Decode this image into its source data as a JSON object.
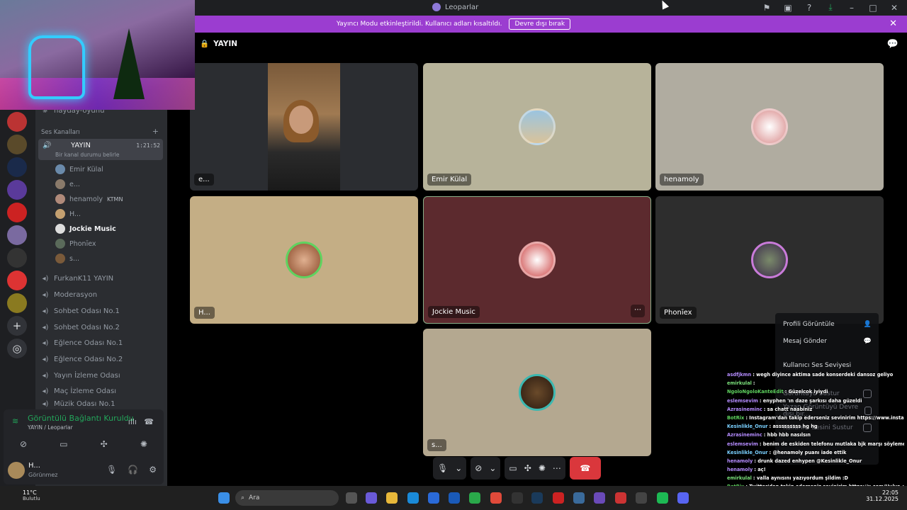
{
  "window": {
    "title": "Leoparlar"
  },
  "notice": {
    "text": "Yayıncı Modu etkinleştirildi. Kullanıcı adları kısaltıldı.",
    "button": "Devre dışı bırak"
  },
  "sidebar": {
    "top_channel": "hayday-oyunu",
    "section_title": "Ses Kanalları",
    "active_channel": {
      "name": "YAYIN",
      "status": "Bir kanal durumu belirle",
      "timer": "1:21:52"
    },
    "members": [
      {
        "name": "Emir Külal",
        "tag": ""
      },
      {
        "name": "e...",
        "tag": ""
      },
      {
        "name": "henamoly",
        "tag": "KTMN"
      },
      {
        "name": "H...",
        "tag": ""
      },
      {
        "name": "Jockie Music",
        "tag": ""
      },
      {
        "name": "Phonīex",
        "tag": ""
      },
      {
        "name": "s...",
        "tag": ""
      }
    ],
    "channels": [
      "FurkanK11 YAYIN",
      "Moderasyon",
      "Sohbet Odası No.1",
      "Sohbet Odası No.2",
      "Eğlence Odası No.1",
      "Eğlence Odası No.2",
      "Yayın İzleme Odası",
      "Maç İzleme Odası",
      "Müzik Odası No.1"
    ],
    "voice_status": {
      "title": "Görüntülü Bağlantı Kuruldu",
      "sub": "YAYIN / Leoparlar"
    },
    "user": {
      "name": "H...",
      "status": "Görünmez"
    }
  },
  "stage": {
    "header": "YAYIN",
    "tiles": [
      {
        "label": "e...",
        "bg": "#2b2d31"
      },
      {
        "label": "Emir Külal",
        "bg": "#b7b39a"
      },
      {
        "label": "henamoly",
        "bg": "#b0aca0"
      },
      {
        "label": "H...",
        "bg": "#c4ae85"
      },
      {
        "label": "Jockie Music",
        "bg": "#5c2a2e"
      },
      {
        "label": "Phonīex",
        "bg": "#2d2d2d"
      },
      {
        "label": "s...",
        "bg": "#b4a890"
      }
    ]
  },
  "context_menu": {
    "items": [
      "Profili Görüntüle",
      "Mesaj Gönder",
      "Kullanıcı Ses Seviyesi",
      "Görüntüyü Sustur",
      "Yazan Görüntüyü Devre dışı bır...",
      "Kullanıcı Sesini Sustur"
    ]
  },
  "chat": [
    {
      "user": "asdfjkmn",
      "text": ": wegh diyince aktima sade konserdeki dansoz geliyo",
      "color": "#b58cff"
    },
    {
      "user": "emirkulal",
      "text": ":",
      "color": "#7be07b"
    },
    {
      "user": "NgoloNgoloKanteEdit",
      "text": ": Güzelcok iyiydi",
      "color": "#5fd35f"
    },
    {
      "user": "eslemsevim",
      "text": ": enyphen 'ın daze şarkısı daha güzeldi",
      "color": "#b58cff"
    },
    {
      "user": "Azrasineminc",
      "text": ": sa chatt naabiniz",
      "color": "#b58cff"
    },
    {
      "user": "BotRix",
      "text": ": Instagram'dan takip ederseniz sevinirim https://www.instagram.com/hulyayar/",
      "color": "#5fd35f"
    },
    {
      "user": "Kesinlikle_Onur",
      "text": ": asssssssss hg hg",
      "color": "#7ad0ff"
    },
    {
      "user": "Azrasineminc",
      "text": ": hbb hbb nasılsın",
      "color": "#b58cff"
    },
    {
      "user": "eslemsevim",
      "text": ": benim de eskiden telefonu mutlaka bjk marşı söylemesi şildkgldgsg",
      "color": "#b58cff"
    },
    {
      "user": "Kesinlikle_Onur",
      "text": ": @henamoly puanı iade ettik",
      "color": "#7ad0ff"
    },
    {
      "user": "henamoly",
      "text": ": drunk dazed enhypen @Kesinlikle_Onur",
      "color": "#b58cff"
    },
    {
      "user": "henamoly",
      "text": ": aç!",
      "color": "#b58cff"
    },
    {
      "user": "emirkulal",
      "text": ": valla aynısını yazıyordum şildim :D",
      "color": "#7be07b"
    },
    {
      "user": "BotRix",
      "text": ": Twitter'dan takip ederseniz sevinirim https://x.com/Hulya_yarr",
      "color": "#5fd35f"
    }
  ],
  "taskbar": {
    "weather_temp": "11°C",
    "weather_desc": "Bulutlu",
    "search_placeholder": "Ara",
    "time": "22:05",
    "date": "31.12.2025"
  },
  "colors": {
    "accent": "#9b3dd0",
    "hangup": "#da373c",
    "connected": "#23a55a"
  }
}
